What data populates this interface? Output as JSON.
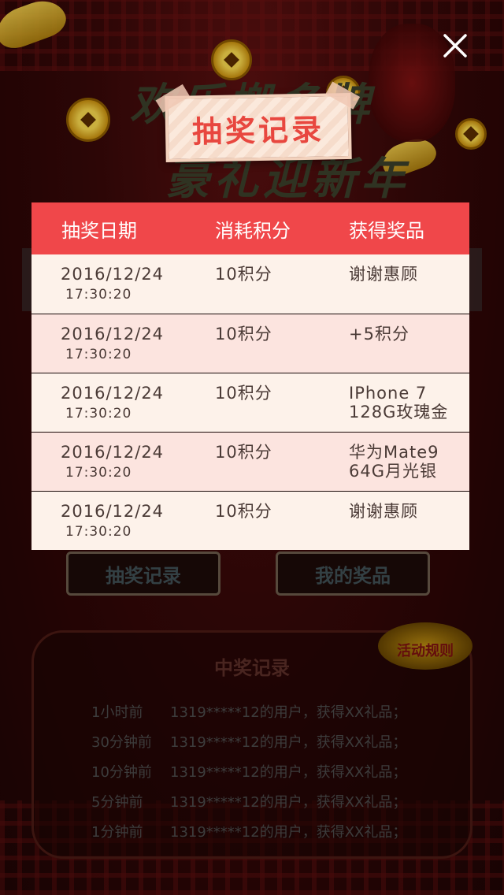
{
  "background": {
    "page_heading_line1": "欢乐搬多牌",
    "page_heading_line2": "豪礼迎新年",
    "buttons": {
      "records_label": "抽奖记录",
      "my_prizes_label": "我的奖品"
    },
    "rules_label": "活动规则",
    "winners": {
      "title": "中奖记录",
      "items": [
        {
          "time": "1小时前",
          "text": "1319*****12的用户，获得XX礼品；"
        },
        {
          "time": "30分钟前",
          "text": "1319*****12的用户，获得XX礼品；"
        },
        {
          "time": "10分钟前",
          "text": "1319*****12的用户，获得XX礼品；"
        },
        {
          "time": "5分钟前",
          "text": "1319*****12的用户，获得XX礼品；"
        },
        {
          "time": "1分钟前",
          "text": "1319*****12的用户，获得XX礼品；"
        }
      ]
    }
  },
  "modal": {
    "title": "抽奖记录",
    "close_icon": "close-icon",
    "columns": [
      "抽奖日期",
      "消耗积分",
      "获得奖品"
    ],
    "rows": [
      {
        "date": "2016/12/24",
        "time": "17:30:20",
        "points": "10积分",
        "prize_line1": "谢谢惠顾",
        "prize_line2": ""
      },
      {
        "date": "2016/12/24",
        "time": "17:30:20",
        "points": "10积分",
        "prize_line1": "+5积分",
        "prize_line2": ""
      },
      {
        "date": "2016/12/24",
        "time": "17:30:20",
        "points": "10积分",
        "prize_line1": "IPhone 7",
        "prize_line2": "128G玫瑰金"
      },
      {
        "date": "2016/12/24",
        "time": "17:30:20",
        "points": "10积分",
        "prize_line1": "华为Mate9",
        "prize_line2": "64G月光银"
      },
      {
        "date": "2016/12/24",
        "time": "17:30:20",
        "points": "10积分",
        "prize_line1": "谢谢惠顾",
        "prize_line2": ""
      }
    ]
  },
  "colors": {
    "header_red": "#f0474a",
    "row_light": "#fdf2ea",
    "row_pink": "#fce4df",
    "title_red": "#e8473f"
  }
}
